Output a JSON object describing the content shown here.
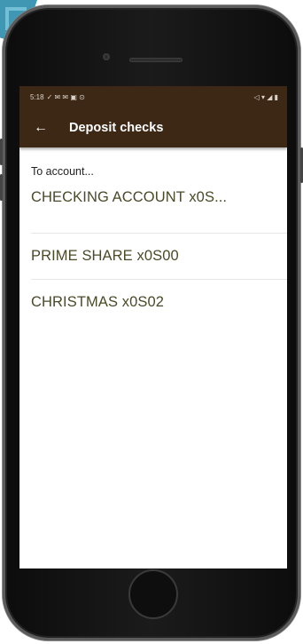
{
  "status_bar": {
    "time": "5:18",
    "left_icons": "✓ ✉ ✉ ▣ ⊙",
    "right_icons": "◁ ▾ ◢ ▮"
  },
  "app_bar": {
    "back_icon": "←",
    "title": "Deposit checks"
  },
  "content": {
    "section_label": "To account...",
    "accounts": [
      "CHECKING ACCOUNT x0S...",
      "PRIME SHARE x0S00",
      "CHRISTMAS x0S02"
    ]
  },
  "colors": {
    "app_bar": "#3d2816",
    "account_text": "#4a4a28",
    "corner_accent": "#3f97b3"
  },
  "icons": {
    "back": "arrow-left-icon",
    "camera": "front-camera-icon",
    "home": "home-button-icon"
  }
}
